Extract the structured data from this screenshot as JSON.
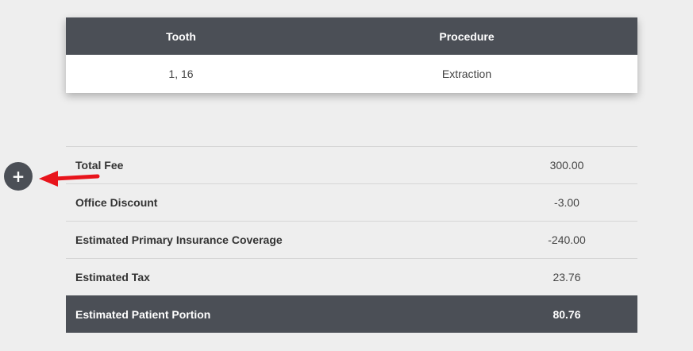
{
  "procedures": {
    "headers": {
      "tooth": "Tooth",
      "procedure": "Procedure"
    },
    "rows": [
      {
        "tooth": "1, 16",
        "procedure": "Extraction"
      }
    ]
  },
  "summary": {
    "rows": [
      {
        "label": "Total Fee",
        "value": "300.00"
      },
      {
        "label": "Office Discount",
        "value": "-3.00"
      },
      {
        "label": "Estimated Primary Insurance Coverage",
        "value": "-240.00"
      },
      {
        "label": "Estimated Tax",
        "value": "23.76"
      }
    ],
    "total": {
      "label": "Estimated Patient Portion",
      "value": "80.76"
    }
  },
  "expand_button": {
    "symbol": "+",
    "icon": "plus-icon"
  },
  "annotation": {
    "icon": "arrow-left-icon",
    "color": "#e8141b"
  }
}
